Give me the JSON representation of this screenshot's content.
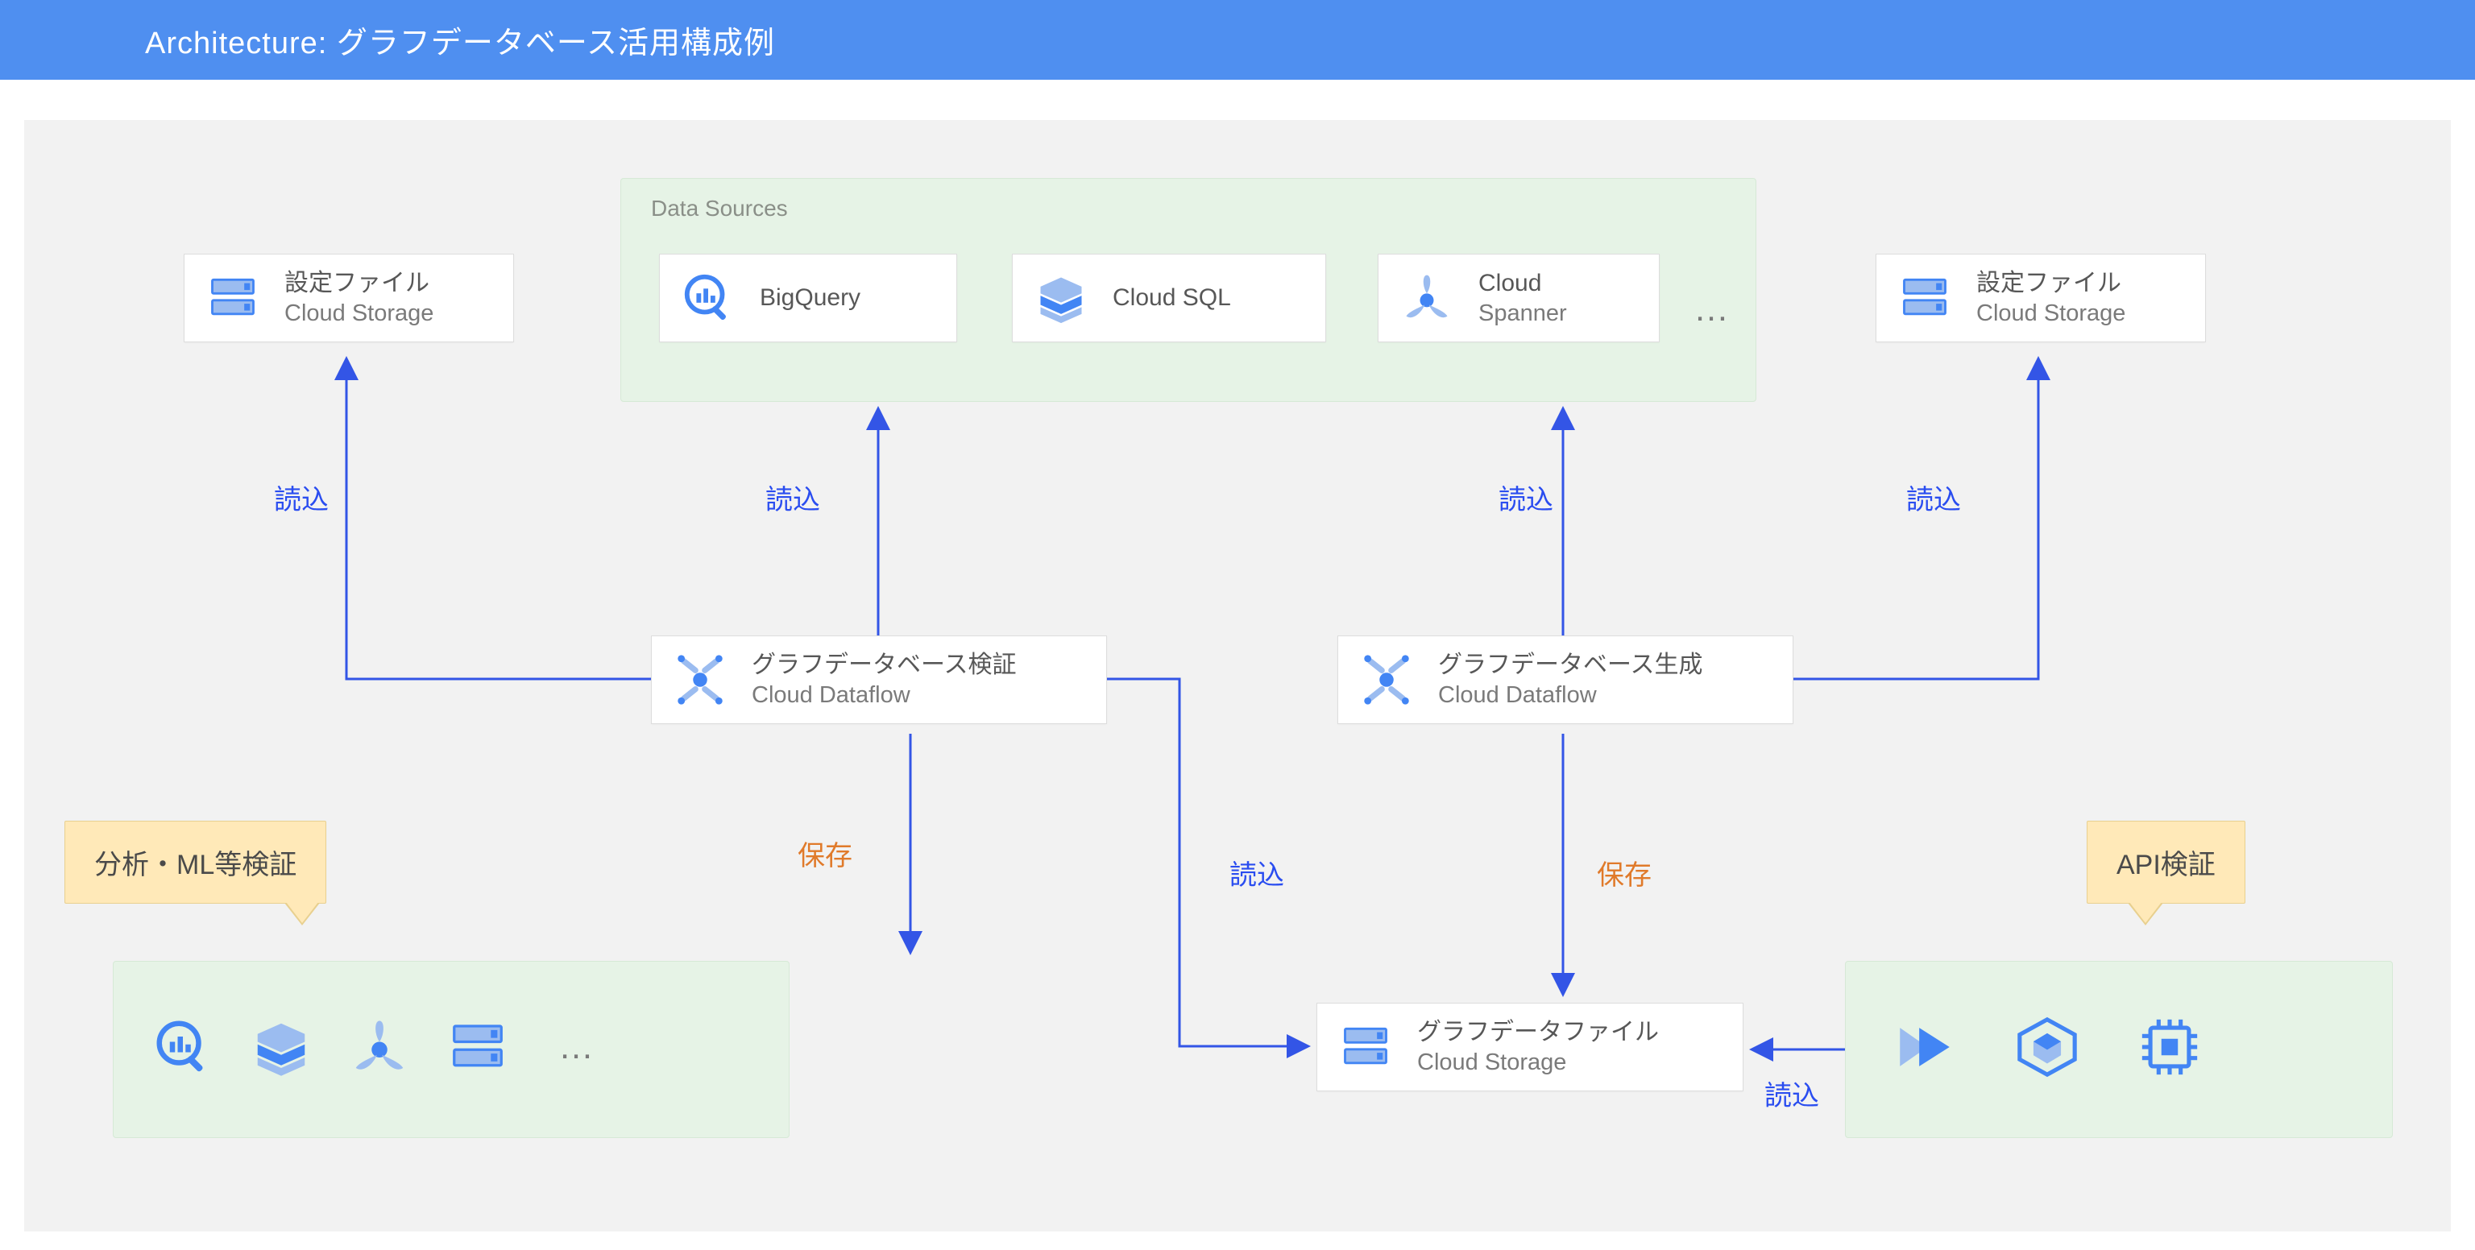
{
  "header": {
    "title": "Architecture: グラフデータベース活用構成例"
  },
  "groups": {
    "dataSources": {
      "title": "Data Sources"
    }
  },
  "cards": {
    "configLeft": {
      "t1": "設定ファイル",
      "t2": "Cloud Storage"
    },
    "bigquery": {
      "t1": "BigQuery"
    },
    "cloudsql": {
      "t1": "Cloud SQL"
    },
    "spanner": {
      "t1": "Cloud",
      "t2": "Spanner"
    },
    "configRight": {
      "t1": "設定ファイル",
      "t2": "Cloud Storage"
    },
    "dfVerify": {
      "t1": "グラフデータベース検証",
      "t2": "Cloud Dataflow"
    },
    "dfGenerate": {
      "t1": "グラフデータベース生成",
      "t2": "Cloud Dataflow"
    },
    "graphStorage": {
      "t1": "グラフデータファイル",
      "t2": "Cloud Storage"
    }
  },
  "callouts": {
    "left": "分析・ML等検証",
    "right": "API検証"
  },
  "labels": {
    "read": "読込",
    "save": "保存"
  },
  "ellipsis": "…"
}
